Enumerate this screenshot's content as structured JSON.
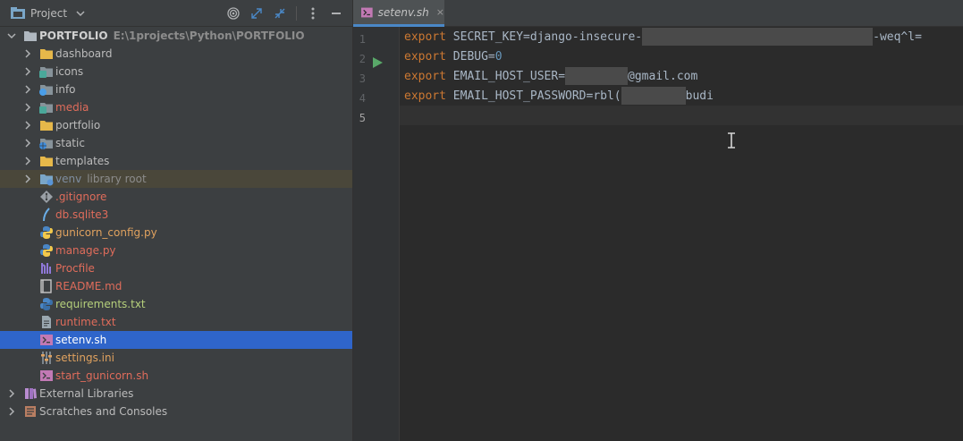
{
  "project_panel": {
    "title": "Project",
    "tree": [
      {
        "level": 0,
        "arrow": "down",
        "icon": "folder-icon",
        "label": "PORTFOLIO",
        "hint": "E:\\1projects\\Python\\PORTFOLIO",
        "color": "white",
        "bold": true
      },
      {
        "level": 1,
        "arrow": "right",
        "icon": "folder-icon",
        "label": "dashboard",
        "color": "default"
      },
      {
        "level": 1,
        "arrow": "right",
        "icon": "folder-icon",
        "label": "icons",
        "color": "default"
      },
      {
        "level": 1,
        "arrow": "right",
        "icon": "folder-icon",
        "label": "info",
        "color": "default"
      },
      {
        "level": 1,
        "arrow": "right",
        "icon": "folder-icon",
        "label": "media",
        "color": "red"
      },
      {
        "level": 1,
        "arrow": "right",
        "icon": "folder-icon",
        "label": "portfolio",
        "color": "default"
      },
      {
        "level": 1,
        "arrow": "right",
        "icon": "folder-icon",
        "label": "static",
        "color": "default"
      },
      {
        "level": 1,
        "arrow": "right",
        "icon": "folder-icon",
        "label": "templates",
        "color": "default"
      },
      {
        "level": 1,
        "arrow": "right",
        "icon": "folder-icon",
        "label": "venv",
        "hint": "library root",
        "color": "dim",
        "state": "excluded"
      },
      {
        "level": 1,
        "icon": "git-icon",
        "label": ".gitignore",
        "color": "red"
      },
      {
        "level": 1,
        "icon": "database-icon",
        "label": "db.sqlite3",
        "color": "red"
      },
      {
        "level": 1,
        "icon": "python-icon",
        "label": "gunicorn_config.py",
        "color": "orange"
      },
      {
        "level": 1,
        "icon": "python-icon",
        "label": "manage.py",
        "color": "red"
      },
      {
        "level": 1,
        "icon": "procfile-icon",
        "label": "Procfile",
        "color": "red"
      },
      {
        "level": 1,
        "icon": "markdown-icon",
        "label": "README.md",
        "color": "red"
      },
      {
        "level": 1,
        "icon": "python-req-icon",
        "label": "requirements.txt",
        "color": "green"
      },
      {
        "level": 1,
        "icon": "text-file-icon",
        "label": "runtime.txt",
        "color": "red"
      },
      {
        "level": 1,
        "icon": "shell-icon",
        "label": "setenv.sh",
        "color": "default",
        "state": "selected"
      },
      {
        "level": 1,
        "icon": "settings-file-icon",
        "label": "settings.ini",
        "color": "orange"
      },
      {
        "level": 1,
        "icon": "shell-icon",
        "label": "start_gunicorn.sh",
        "color": "red"
      },
      {
        "level": 0,
        "arrow": "right",
        "icon": "library-icon",
        "label": "External Libraries",
        "color": "default"
      },
      {
        "level": 0,
        "arrow": "right",
        "icon": "scratches-icon",
        "label": "Scratches and Consoles",
        "color": "default"
      }
    ]
  },
  "editor": {
    "tab_label": "setenv.sh",
    "tab_close": "×",
    "line_numbers": [
      "1",
      "2",
      "3",
      "4",
      "5"
    ],
    "lines": [
      {
        "kw": "export",
        "text": " SECRET_KEY=django-insecure-",
        "tail": "-weq^l="
      },
      {
        "kw": "export",
        "text": " DEBUG=",
        "num": "0"
      },
      {
        "kw": "export",
        "text": " EMAIL_HOST_USER=",
        "tail": "@gmail.com"
      },
      {
        "kw": "export",
        "text": " EMAIL_HOST_PASSWORD=rbl(",
        "tail": "budi"
      }
    ]
  },
  "colors": {
    "selection": "#2f65ca",
    "keyword": "#cc7832",
    "code_text": "#a9b7c6",
    "number": "#6897bb",
    "run_marker": "#59a869"
  }
}
